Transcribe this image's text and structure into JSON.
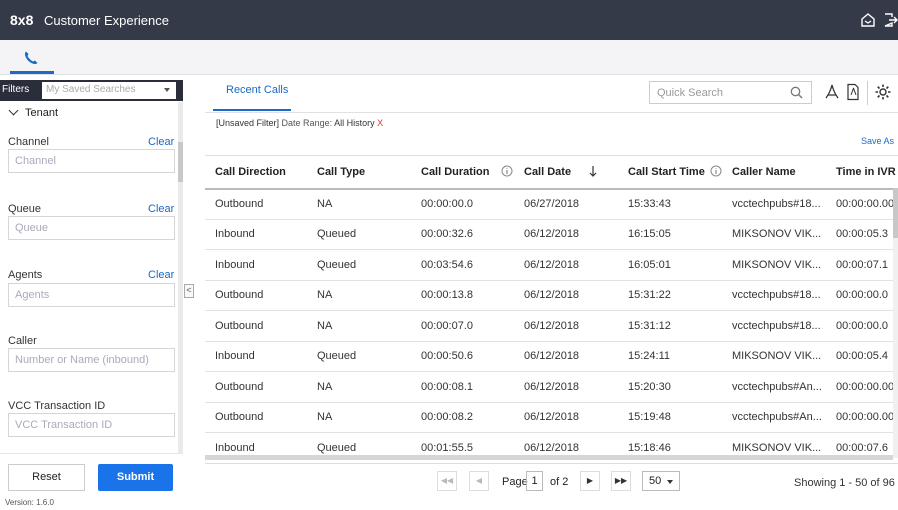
{
  "topbar": {
    "brand": "8x8",
    "app_name": "Customer Experience"
  },
  "sidebar": {
    "filters_label": "Filters",
    "saved_search_placeholder": "My Saved Searches",
    "tenant_label": "Tenant",
    "fields": [
      {
        "label": "Channel",
        "clear": "Clear",
        "placeholder": "Channel"
      },
      {
        "label": "Queue",
        "clear": "Clear",
        "placeholder": "Queue"
      },
      {
        "label": "Agents",
        "clear": "Clear",
        "placeholder": "Agents"
      },
      {
        "label": "Caller",
        "placeholder": "Number or Name (inbound)"
      },
      {
        "label": "VCC Transaction ID",
        "placeholder": "VCC Transaction ID"
      }
    ],
    "reset_label": "Reset",
    "submit_label": "Submit",
    "version": "Version: 1.6.0"
  },
  "main": {
    "tab_label": "Recent Calls",
    "search_placeholder": "Quick Search",
    "unsaved_filter": "[Unsaved Filter]",
    "date_range_label": "Date Range:",
    "date_range_value": "All History",
    "remove_filter": "X",
    "save_as": "Save As"
  },
  "table": {
    "columns": [
      "Call Direction",
      "Call Type",
      "Call Duration",
      "Call Date",
      "Call Start Time",
      "Caller Name",
      "Time in IVR"
    ],
    "rows": [
      [
        "Outbound",
        "NA",
        "00:00:00.0",
        "06/27/2018",
        "15:33:43",
        "vcctechpubs#18...",
        "00:00:00.00"
      ],
      [
        "Inbound",
        "Queued",
        "00:00:32.6",
        "06/12/2018",
        "16:15:05",
        "MIKSONOV VIK...",
        "00:00:05.3"
      ],
      [
        "Inbound",
        "Queued",
        "00:03:54.6",
        "06/12/2018",
        "16:05:01",
        "MIKSONOV VIK...",
        "00:00:07.1"
      ],
      [
        "Outbound",
        "NA",
        "00:00:13.8",
        "06/12/2018",
        "15:31:22",
        "vcctechpubs#18...",
        "00:00:00.0"
      ],
      [
        "Outbound",
        "NA",
        "00:00:07.0",
        "06/12/2018",
        "15:31:12",
        "vcctechpubs#18...",
        "00:00:00.0"
      ],
      [
        "Inbound",
        "Queued",
        "00:00:50.6",
        "06/12/2018",
        "15:24:11",
        "MIKSONOV VIK...",
        "00:00:05.4"
      ],
      [
        "Outbound",
        "NA",
        "00:00:08.1",
        "06/12/2018",
        "15:20:30",
        "vcctechpubs#An...",
        "00:00:00.00"
      ],
      [
        "Outbound",
        "NA",
        "00:00:08.2",
        "06/12/2018",
        "15:19:48",
        "vcctechpubs#An...",
        "00:00:00.00"
      ],
      [
        "Inbound",
        "Queued",
        "00:01:55.5",
        "06/12/2018",
        "15:18:46",
        "MIKSONOV VIK...",
        "00:00:07.6"
      ]
    ]
  },
  "pager": {
    "page_label": "Page",
    "page_number": "1",
    "of_label": "of 2",
    "page_size": "50",
    "showing": "Showing 1 - 50 of 96"
  },
  "colors": {
    "header_bg": "#353a48",
    "accent": "#1a6ac6",
    "submit_bg": "#1a73e8"
  }
}
